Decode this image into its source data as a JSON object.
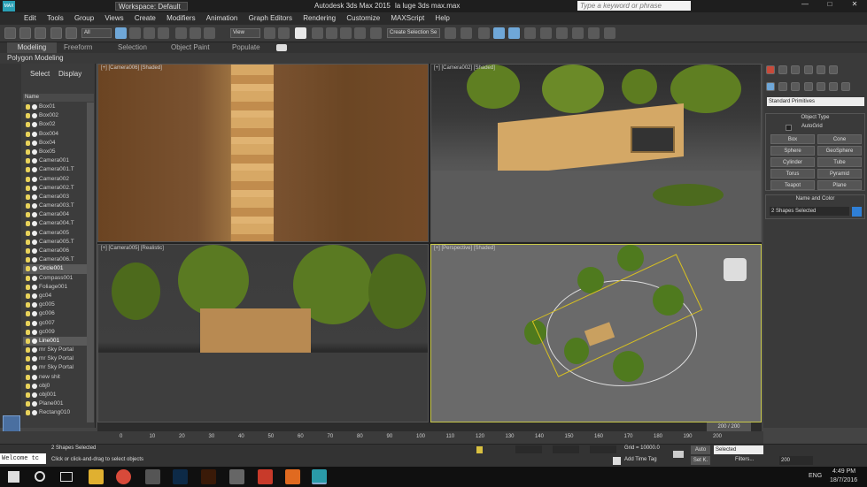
{
  "titlebar": {
    "workspace": "Workspace: Default",
    "app": "Autodesk 3ds Max  2015",
    "file": "la luge 3ds max.max",
    "search_placeholder": "Type a keyword or phrase"
  },
  "menu": [
    "Edit",
    "Tools",
    "Group",
    "Views",
    "Create",
    "Modifiers",
    "Animation",
    "Graph Editors",
    "Rendering",
    "Customize",
    "MAXScript",
    "Help"
  ],
  "toolbar": {
    "filter": "All",
    "coord": "View",
    "selection_set": "Create Selection Se"
  },
  "ribbon": {
    "tabs": [
      "Modeling",
      "Freeform",
      "Selection",
      "Object Paint",
      "Populate"
    ],
    "sub": "Polygon Modeling"
  },
  "explorer": {
    "tabs": [
      "Select",
      "Display"
    ],
    "header": "Name",
    "items": [
      "Box01",
      "Box002",
      "Box02",
      "Box004",
      "Box04",
      "Box05",
      "Camera001",
      "Camera001.T",
      "Camera002",
      "Camera002.T",
      "Camera003",
      "Camera003.T",
      "Camera004",
      "Camera004.T",
      "Camera005",
      "Camera005.T",
      "Camera006",
      "Camera006.T",
      "Circle001",
      "Compass001",
      "Foliage001",
      "gc04",
      "gc005",
      "gc006",
      "gc007",
      "gc009",
      "Line001",
      "mr Sky Portal",
      "mr Sky Portal",
      "mr Sky Portal",
      "new shit",
      "obj0",
      "obj001",
      "Plane001",
      "Rectang010"
    ]
  },
  "viewports": {
    "tl": "[+] [Camera006] [Shaded]",
    "tr": "[+] [Camera002] [Shaded]",
    "bl": "[+] [Camera005] [Realistic]",
    "br": "[+] [Perspective] [Shaded]"
  },
  "cmdpanel": {
    "category": "Standard Primitives",
    "object_type": "Object Type",
    "autogrid": "AutoGrid",
    "buttons": [
      "Box",
      "Cone",
      "Sphere",
      "GeoSphere",
      "Cylinder",
      "Tube",
      "Torus",
      "Pyramid",
      "Teapot",
      "Plane"
    ],
    "name_color": "Name and Color",
    "name_field": "2 Shapes Selected",
    "color": "#2f7fd6"
  },
  "timeline": {
    "frame": "200 / 200",
    "ticks": [
      "0",
      "10",
      "20",
      "30",
      "40",
      "50",
      "60",
      "70",
      "80",
      "90",
      "100",
      "110",
      "120",
      "130",
      "140",
      "150",
      "160",
      "170",
      "180",
      "190",
      "200"
    ]
  },
  "status": {
    "selected": "2 Shapes Selected",
    "prompt": "Click or click-and-drag to select objects",
    "grid": "Grid = 10000.0",
    "add_time_tag": "Add Time Tag",
    "auto": "Auto",
    "selected_dd": "Selected",
    "set_key": "Set K.",
    "filters": "Filters...",
    "frame": "200",
    "listener": "Welcome tc"
  },
  "taskbar": {
    "time": "4:49 PM",
    "date": "18/7/2016",
    "lang": "ENG"
  }
}
